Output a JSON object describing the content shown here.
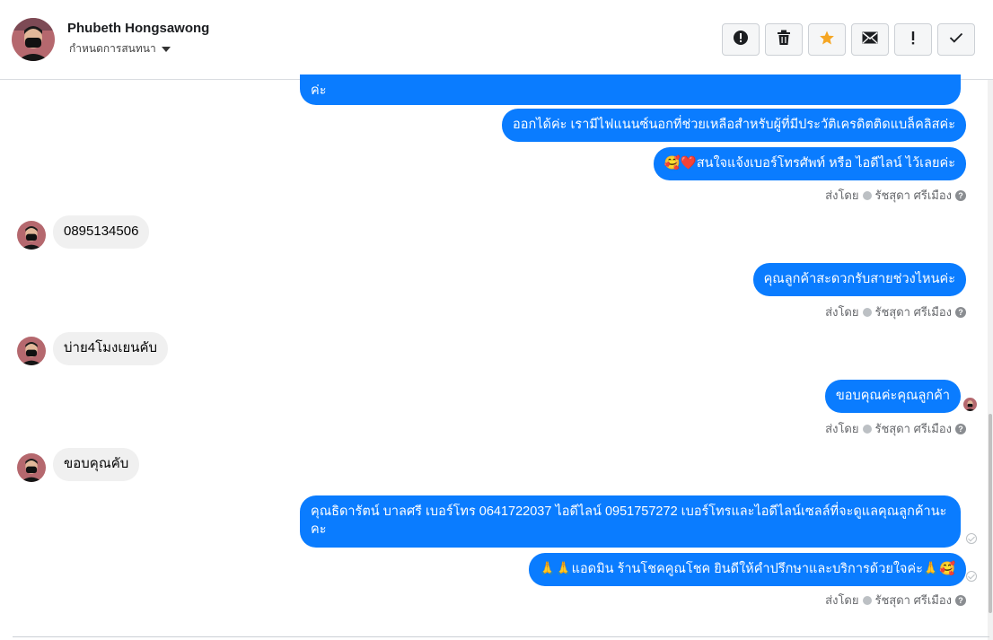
{
  "header": {
    "contact_name": "Phubeth Hongsawong",
    "assign_label": "กำหนดการสนทนา",
    "toolbar": [
      {
        "icon": "alert-icon",
        "label": "!"
      },
      {
        "icon": "trash-icon",
        "label": ""
      },
      {
        "icon": "star-icon",
        "label": ""
      },
      {
        "icon": "mail-icon",
        "label": ""
      },
      {
        "icon": "exclamation-icon",
        "label": "!"
      },
      {
        "icon": "check-icon",
        "label": ""
      }
    ]
  },
  "colors": {
    "outgoing": "#0a7cff",
    "incoming": "#f0f0f0",
    "star": "#f5a623"
  },
  "messages": {
    "out1_tail": "ค่ะ",
    "out2": "ออกได้ค่ะ เรามีไฟแนนซ์นอกที่ช่วยเหลือสำหรับผู้ที่มีประวัติเครดิตติดแบล็คลิสค่ะ",
    "out3": "🥰❤️สนใจแจ้งเบอร์โทรศัพท์ หรือ ไอดีไลน์  ไว้เลยค่ะ",
    "sent_by_1": "ส่งโดย",
    "agent_1": "รัชสุดา ศรีเมือง",
    "in1": "0895134506",
    "out4": "คุณลูกค้าสะดวกรับสายช่วงไหนค่ะ",
    "sent_by_2": "ส่งโดย",
    "agent_2": "รัชสุดา ศรีเมือง",
    "in2": "บ่าย4โมงเยนคับ",
    "out5": "ขอบคุณค่ะคุณลูกค้า",
    "sent_by_3": "ส่งโดย",
    "agent_3": "รัชสุดา ศรีเมือง",
    "in3": "ขอบคุณคับ",
    "out6": "คุณธิดารัตน์ บาลศรี เบอร์โทร 0641722037  ไอดีไลน์ 0951757272   เบอร์โทรและไอดีไลน์เซลล์ที่จะดูแลคุณลูกค้านะคะ",
    "out7": "🙏🙏แอดมิน ร้านโชคคูณโชค ยินดีให้คำปรึกษาและบริการด้วยใจค่ะ🙏🥰",
    "sent_by_4": "ส่งโดย",
    "agent_4": "รัชสุดา ศรีเมือง",
    "help": "?"
  }
}
